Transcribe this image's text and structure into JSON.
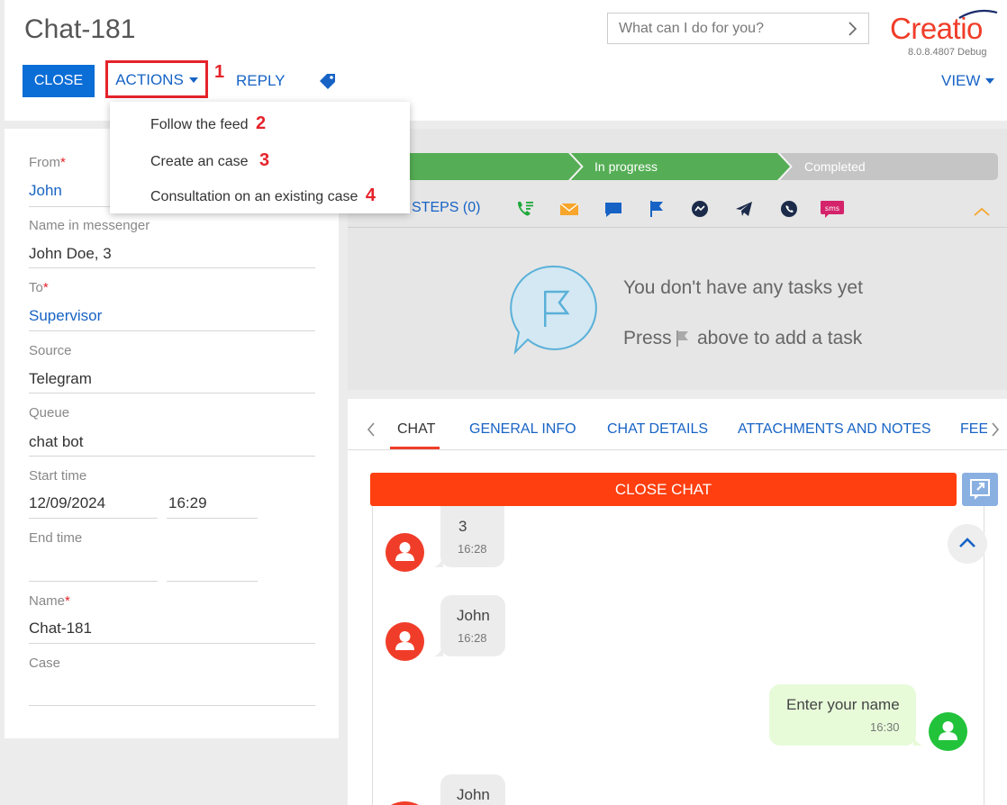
{
  "header": {
    "title": "Chat-181",
    "search_placeholder": "What can I do for you?",
    "logo_text": "Creatio",
    "version": "8.0.8.4807 Debug"
  },
  "toolbar": {
    "close_label": "CLOSE",
    "actions_label": "ACTIONS",
    "reply_label": "REPLY",
    "view_label": "VIEW",
    "annotation_1": "1"
  },
  "actions_menu": {
    "items": [
      {
        "label": "Follow the feed",
        "annotation": "2"
      },
      {
        "label": "Create an case",
        "annotation": "3"
      },
      {
        "label": "Consultation on an existing case",
        "annotation": "4"
      }
    ]
  },
  "form": {
    "from_label": "From",
    "from_value": "John",
    "messenger_name_label": "Name in messenger",
    "messenger_name_value": "John Doe, 3",
    "to_label": "To",
    "to_value": "Supervisor",
    "source_label": "Source",
    "source_value": "Telegram",
    "queue_label": "Queue",
    "queue_value": "chat bot",
    "start_time_label": "Start time",
    "start_date": "12/09/2024",
    "start_time": "16:29",
    "end_time_label": "End time",
    "name_label": "Name",
    "name_value": "Chat-181",
    "case_label": "Case",
    "required_mark": "*"
  },
  "stages": {
    "in_progress_label": "In progress",
    "completed_label": "Completed",
    "active_color": "#55ae55",
    "inactive_color": "#c5c5c5"
  },
  "tasks": {
    "steps_label": "STEPS (0)",
    "empty_title": "You don't have any tasks yet",
    "press_label": "Press",
    "press_suffix": "above to add a task",
    "step_icons": [
      "call-icon",
      "email-icon",
      "chat-icon",
      "flag-icon",
      "messenger-icon",
      "telegram-icon",
      "whatsapp-icon",
      "sms-icon"
    ],
    "sms_text": "sms"
  },
  "tabs": {
    "items": [
      "CHAT",
      "GENERAL INFO",
      "CHAT DETAILS",
      "ATTACHMENTS AND NOTES",
      "FEE"
    ]
  },
  "chat": {
    "close_chat_label": "CLOSE CHAT",
    "messages": [
      {
        "direction": "in",
        "text": "3",
        "time": "16:28"
      },
      {
        "direction": "in",
        "text": "John",
        "time": "16:28"
      },
      {
        "direction": "out",
        "text": "Enter your name",
        "time": "16:30"
      },
      {
        "direction": "in",
        "text": "John",
        "time": ""
      }
    ]
  }
}
